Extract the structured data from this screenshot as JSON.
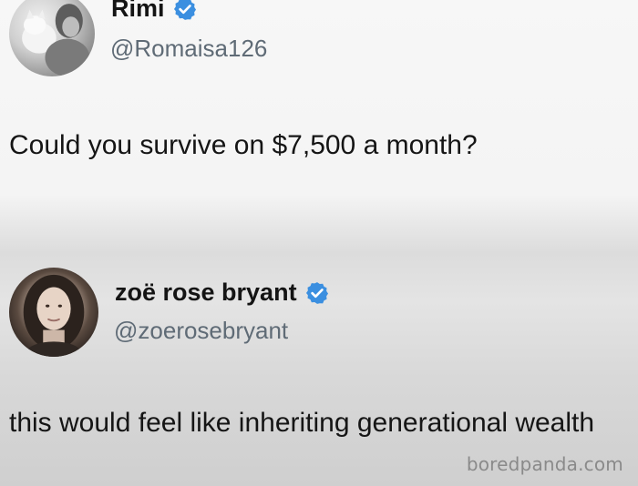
{
  "tweets": [
    {
      "display_name": "Rimi",
      "handle": "@Romaisa126",
      "verified": true,
      "text": "Could you survive on $7,500 a month?"
    },
    {
      "display_name": "zoë rose bryant",
      "handle": "@zoerosebryant",
      "verified": true,
      "text": "this would feel like inheriting generational wealth"
    }
  ],
  "watermark": "boredpanda.com",
  "colors": {
    "verified_badge": "#3b8fe0",
    "handle_text": "#5f6b76",
    "primary_text": "#151515",
    "watermark_text": "#8a8a8a"
  },
  "icons": {
    "verified": "verified-badge-icon"
  }
}
